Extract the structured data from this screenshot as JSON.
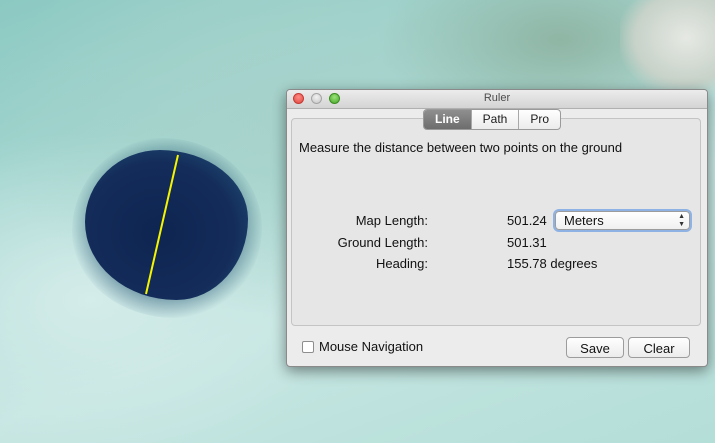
{
  "window": {
    "title": "Ruler"
  },
  "tabs": [
    {
      "label": "Line",
      "active": true
    },
    {
      "label": "Path",
      "active": false
    },
    {
      "label": "Pro",
      "active": false
    }
  ],
  "description": "Measure the distance between two points on the ground",
  "measurements": {
    "map_length_label": "Map Length:",
    "map_length_value": "501.24",
    "ground_length_label": "Ground Length:",
    "ground_length_value": "501.31",
    "heading_label": "Heading:",
    "heading_value": "155.78 degrees"
  },
  "units_select": {
    "selected": "Meters"
  },
  "mouse_navigation": {
    "label": "Mouse Navigation",
    "checked": false
  },
  "buttons": {
    "save": "Save",
    "clear": "Clear"
  },
  "colors": {
    "measure_line": "#f5f500",
    "close": "#e0443e",
    "minimize": "#c4c4c4",
    "zoom": "#46a727",
    "focus_ring": "#8db2e3"
  }
}
